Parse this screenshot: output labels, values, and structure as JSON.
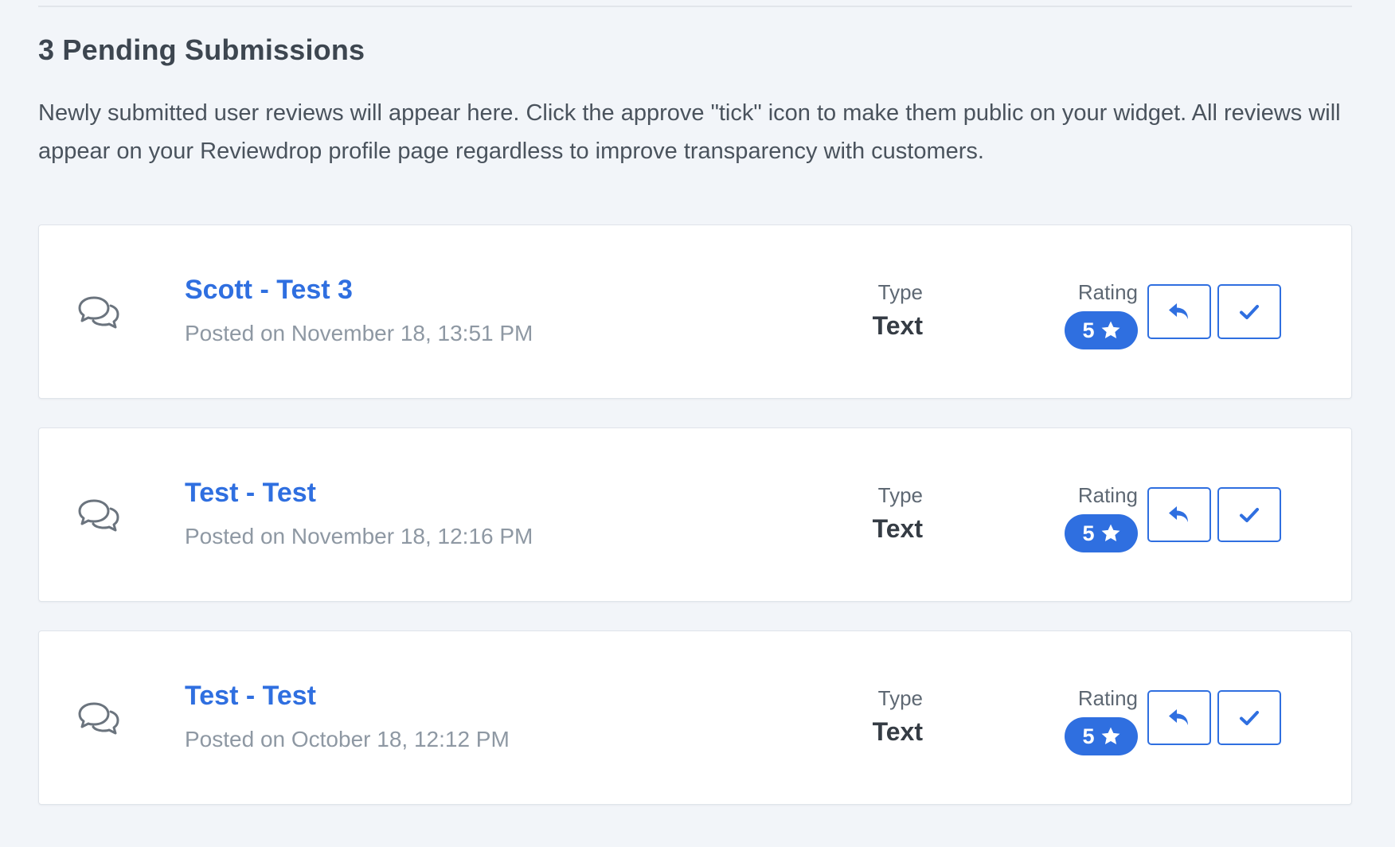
{
  "header": {
    "title": "3 Pending Submissions",
    "description": "Newly submitted user reviews will appear here. Click the approve \"tick\" icon to make them public on your widget. All reviews will appear on your Reviewdrop profile page regardless to improve transparency with customers."
  },
  "labels": {
    "type": "Type",
    "rating": "Rating"
  },
  "submissions": [
    {
      "title": "Scott - Test 3",
      "posted": "Posted on November 18, 13:51 PM",
      "type": "Text",
      "rating": "5",
      "icon": "chat-bubbles-icon"
    },
    {
      "title": "Test - Test",
      "posted": "Posted on November 18, 12:16 PM",
      "type": "Text",
      "rating": "5",
      "icon": "chat-bubbles-icon"
    },
    {
      "title": "Test - Test",
      "posted": "Posted on October 18, 12:12 PM",
      "type": "Text",
      "rating": "5",
      "icon": "chat-bubbles-icon"
    }
  ],
  "colors": {
    "accent": "#2f6fe0",
    "background": "#f2f5f9",
    "card": "#ffffff",
    "muted_text": "#8e98a3"
  }
}
